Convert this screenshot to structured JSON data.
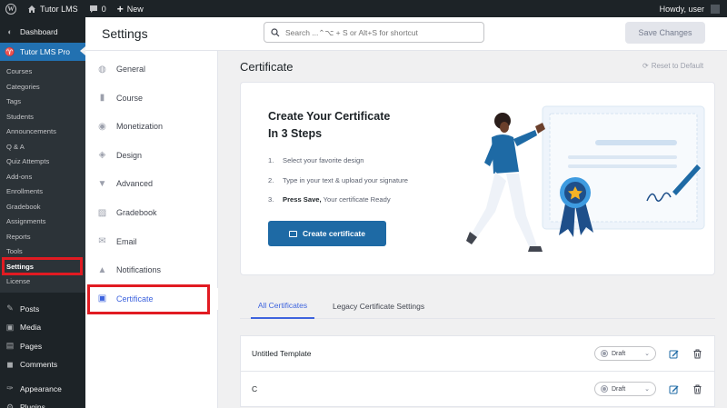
{
  "adminbar": {
    "site_name": "Tutor LMS",
    "comments_count": "0",
    "new_label": "New",
    "greeting": "Howdy, user"
  },
  "sidebar": {
    "dashboard": "Dashboard",
    "tutor_pro": "Tutor LMS Pro",
    "submenu": [
      "Courses",
      "Categories",
      "Tags",
      "Students",
      "Announcements",
      "Q & A",
      "Quiz Attempts",
      "Add-ons",
      "Enrollments",
      "Gradebook",
      "Assignments",
      "Reports",
      "Tools",
      "Settings",
      "License"
    ],
    "current_submenu": "Settings",
    "bottom": [
      {
        "label": "Posts",
        "icon": "pin-icon"
      },
      {
        "label": "Media",
        "icon": "media-icon"
      },
      {
        "label": "Pages",
        "icon": "pages-icon"
      },
      {
        "label": "Comments",
        "icon": "comment-icon"
      },
      {
        "label": "Appearance",
        "icon": "brush-icon"
      },
      {
        "label": "Plugins",
        "icon": "plugin-icon"
      }
    ]
  },
  "header": {
    "title": "Settings",
    "search_placeholder": "Search ...⌃⌥ + S or Alt+S for shortcut",
    "save_label": "Save Changes"
  },
  "settings_nav": [
    {
      "label": "General",
      "icon": "globe-icon"
    },
    {
      "label": "Course",
      "icon": "book-icon"
    },
    {
      "label": "Monetization",
      "icon": "money-icon"
    },
    {
      "label": "Design",
      "icon": "palette-icon"
    },
    {
      "label": "Advanced",
      "icon": "filter-icon"
    },
    {
      "label": "Gradebook",
      "icon": "gradebook-icon"
    },
    {
      "label": "Email",
      "icon": "envelope-icon"
    },
    {
      "label": "Notifications",
      "icon": "bell-icon"
    },
    {
      "label": "Certificate",
      "icon": "certificate-icon"
    }
  ],
  "active_nav": "Certificate",
  "main": {
    "section_title": "Certificate",
    "reset_label": "Reset to Default",
    "card": {
      "title_line1": "Create Your Certificate",
      "title_line2": "In 3 Steps",
      "steps": [
        {
          "num": "1.",
          "text": "Select your favorite design",
          "bold": ""
        },
        {
          "num": "2.",
          "text": "Type in your text & upload your signature",
          "bold": ""
        },
        {
          "num": "3.",
          "bold": "Press Save,",
          "text": " Your certificate Ready"
        }
      ],
      "button_label": "Create certificate"
    },
    "tabs": [
      "All Certificates",
      "Legacy Certificate Settings"
    ],
    "active_tab": "All Certificates",
    "templates": [
      {
        "name": "Untitled Template",
        "status": "Draft"
      },
      {
        "name": "C",
        "status": "Draft"
      }
    ]
  },
  "colors": {
    "wp_dark": "#1d2327",
    "wp_blue": "#2271b1",
    "tutor_blue": "#3e64de",
    "button_blue": "#1e6aa5",
    "highlight_red": "#e11b22"
  }
}
